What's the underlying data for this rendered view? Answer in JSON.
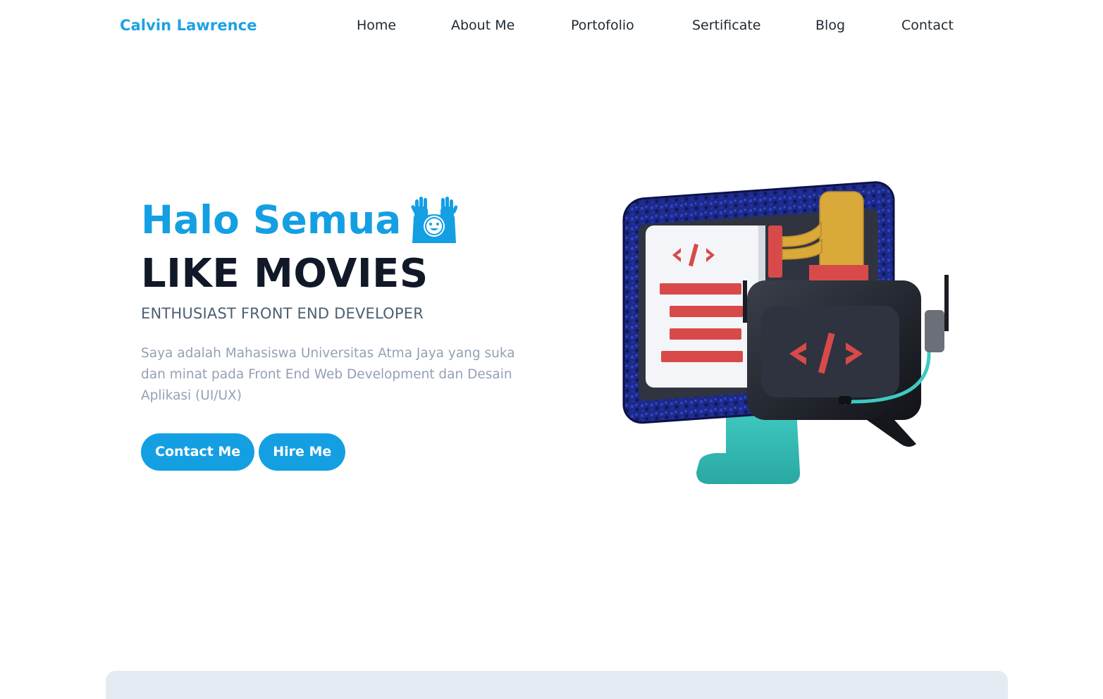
{
  "navbar": {
    "brand": "Calvin Lawrence",
    "links": [
      "Home",
      "About Me",
      "Portofolio",
      "Sertificate",
      "Blog",
      "Contact"
    ]
  },
  "hero": {
    "greeting": "Halo Semua",
    "greeting_icon": "raised-hands-face-icon",
    "role": "LIKE MOVIES",
    "subtitle": "ENTHUSIAST FRONT END DEVELOPER",
    "description": "Saya adalah Mahasiswa Universitas Atma Jaya yang suka dan minat pada Front End Web Development dan Desain Aplikasi (UI/UX)",
    "buttons": {
      "contact": "Contact Me",
      "hire": "Hire Me"
    },
    "illustration_icon": "coding-monitor-illustration"
  },
  "colors": {
    "accent": "#149fe3",
    "heading": "#111827",
    "subtitle": "#4d5f72",
    "muted": "#93a1b5",
    "footer_bg": "#e4ebf3"
  }
}
